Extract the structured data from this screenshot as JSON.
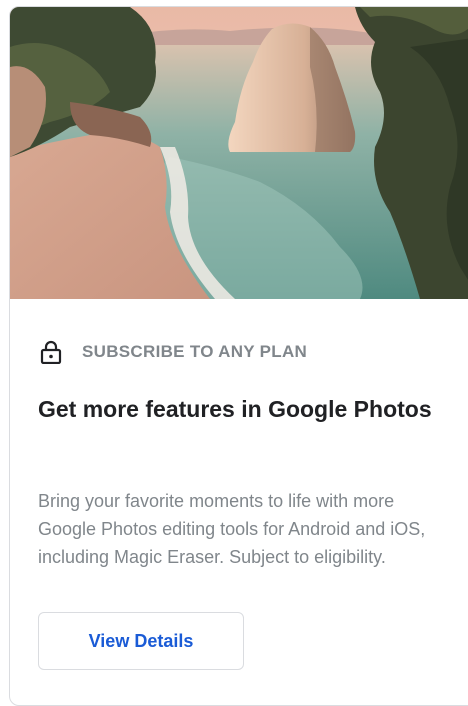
{
  "card": {
    "image_alt": "Coastal beach with rock formation",
    "plan_label": "SUBSCRIBE TO ANY PLAN",
    "title": "Get more features in Google Photos",
    "description": "Bring your favorite moments to life with more Google Photos editing tools for Android and iOS, including Magic Eraser. Subject to eligibility.",
    "button_label": "View Details"
  },
  "icons": {
    "lock": "lock-icon"
  },
  "colors": {
    "accent": "#1a5bd6",
    "muted_text": "#80868b",
    "title_text": "#202124",
    "border": "#dadce0"
  }
}
